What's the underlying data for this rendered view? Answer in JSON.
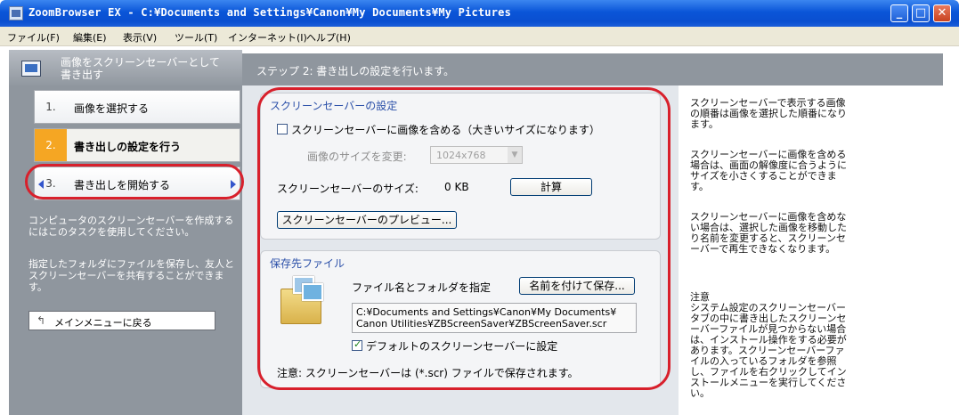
{
  "window": {
    "title": "ZoomBrowser EX  -  C:¥Documents and Settings¥Canon¥My Documents¥My Pictures",
    "min_icon": "minimize-icon",
    "max_icon": "maximize-icon",
    "close_icon": "close-icon"
  },
  "menu": [
    {
      "label": "ファイル(F)"
    },
    {
      "label": "編集(E)"
    },
    {
      "label": "表示(V)"
    },
    {
      "label": "ツール(T)"
    },
    {
      "label": "インターネット(I)"
    },
    {
      "label": "ヘルプ(H)"
    }
  ],
  "sidebar": {
    "header": "画像をスクリーンセーバーとして書き出す",
    "steps": [
      {
        "num": "1.",
        "label": "画像を選択する"
      },
      {
        "num": "2.",
        "label": "書き出しの設定を行う"
      },
      {
        "num": "3.",
        "label": "書き出しを開始する"
      }
    ],
    "desc1": "コンピュータのスクリーンセーバーを作成するにはこのタスクを使用してください。",
    "desc2": "指定したフォルダにファイルを保存し、友人とスクリーンセーバーを共有することができます。",
    "back_label": "メインメニューに戻る"
  },
  "main": {
    "step_header": "ステップ 2: 書き出しの設定を行います。",
    "screensaver_group": {
      "title": "スクリーンセーバーの設定",
      "include_checkbox_label": "スクリーンセーバーに画像を含める（大きいサイズになります）",
      "include_checked": false,
      "resize_label": "画像のサイズを変更:",
      "resize_value": "1024x768",
      "size_label": "スクリーンセーバーのサイズ:",
      "size_value": "0 KB",
      "calc_button": "計算",
      "preview_button": "スクリーンセーバーのプレビュー..."
    },
    "save_group": {
      "title": "保存先ファイル",
      "file_folder_label": "ファイル名とフォルダを指定",
      "save_as_button": "名前を付けて保存...",
      "path_line1": "C:¥Documents and Settings¥Canon¥My Documents¥",
      "path_line2": "Canon Utilities¥ZBScreenSaver¥ZBScreenSaver.scr",
      "default_checkbox_label": "デフォルトのスクリーンセーバーに設定",
      "default_checked": true,
      "note": "注意: スクリーンセーバーは (*.scr) ファイルで保存されます。"
    }
  },
  "help": {
    "p1": "スクリーンセーバーで表示する画像の順番は画像を選択した順番になります。",
    "p2": "スクリーンセーバーに画像を含める場合は、画面の解像度に合うようにサイズを小さくすることができます。",
    "p3": "スクリーンセーバーに画像を含めない場合は、選択した画像を移動したり名前を変更すると、スクリーンセーバーで再生できなくなります。",
    "note_title": "注意",
    "note_body": "システム設定のスクリーンセーバータブの中に書き出したスクリーンセーバーファイルが見つからない場合は、インストール操作をする必要があります。スクリーンセーバーファイルの入っているフォルダを参照し、ファイルを右クリックしてインストールメニューを実行してください。"
  },
  "colors": {
    "titlebar": "#0a55d8",
    "sidebar_bg": "#8f969e",
    "active_step": "#f5a623",
    "callout": "#d8202c",
    "group_title": "#2a4fa8"
  }
}
